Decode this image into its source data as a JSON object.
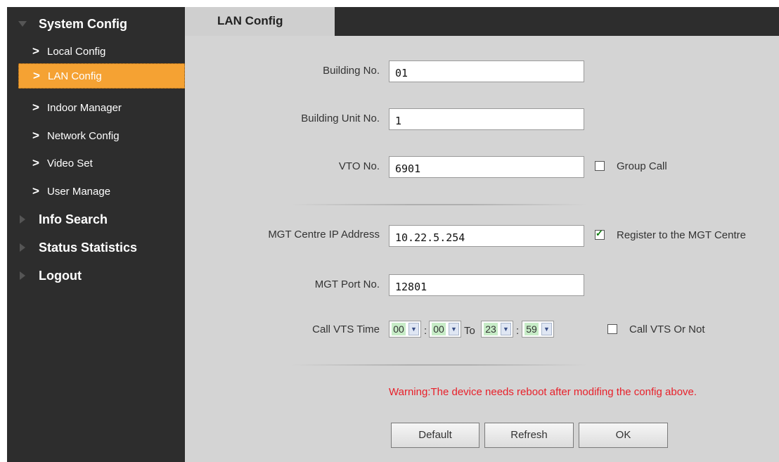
{
  "sidebar": {
    "sections": [
      {
        "label": "System Config",
        "expanded": true
      },
      {
        "label": "Info Search",
        "expanded": false
      },
      {
        "label": "Status Statistics",
        "expanded": false
      },
      {
        "label": "Logout",
        "expanded": false
      }
    ],
    "items": [
      {
        "label": "Local Config",
        "active": false
      },
      {
        "label": "LAN Config",
        "active": true
      },
      {
        "label": "Indoor Manager",
        "active": false
      },
      {
        "label": "Network Config",
        "active": false
      },
      {
        "label": "Video Set",
        "active": false
      },
      {
        "label": "User Manage",
        "active": false
      }
    ],
    "chevron": ">"
  },
  "tab": {
    "label": "LAN Config"
  },
  "form": {
    "building_no": {
      "label": "Building No.",
      "value": "01"
    },
    "building_unit_no": {
      "label": "Building Unit No.",
      "value": "1"
    },
    "vto_no": {
      "label": "VTO No.",
      "value": "6901"
    },
    "group_call": {
      "label": "Group Call",
      "checked": false
    },
    "mgt_ip": {
      "label": "MGT Centre IP Address",
      "value": "10.22.5.254"
    },
    "register_mgt": {
      "label": "Register to the MGT Centre",
      "checked": true
    },
    "mgt_port": {
      "label": "MGT Port No.",
      "value": "12801"
    },
    "call_vts_time": {
      "label": "Call VTS Time",
      "start_hour": "00",
      "start_minute": "00",
      "to_label": "To",
      "end_hour": "23",
      "end_minute": "59",
      "colon": ":"
    },
    "call_vts_or_not": {
      "label": "Call VTS Or Not",
      "checked": false
    }
  },
  "warning": "Warning:The device needs reboot after modifing the config above.",
  "buttons": {
    "default": "Default",
    "refresh": "Refresh",
    "ok": "OK"
  },
  "colors": {
    "sidebar_bg": "#2d2d2d",
    "active_item": "#f5a233",
    "content_bg": "#d4d4d4",
    "warning": "#e8202a",
    "checkbox_check": "#0a7a0a"
  },
  "icons": {
    "dropdown": "▼",
    "section_collapsed": "triangle-right",
    "section_expanded": "triangle-down"
  }
}
